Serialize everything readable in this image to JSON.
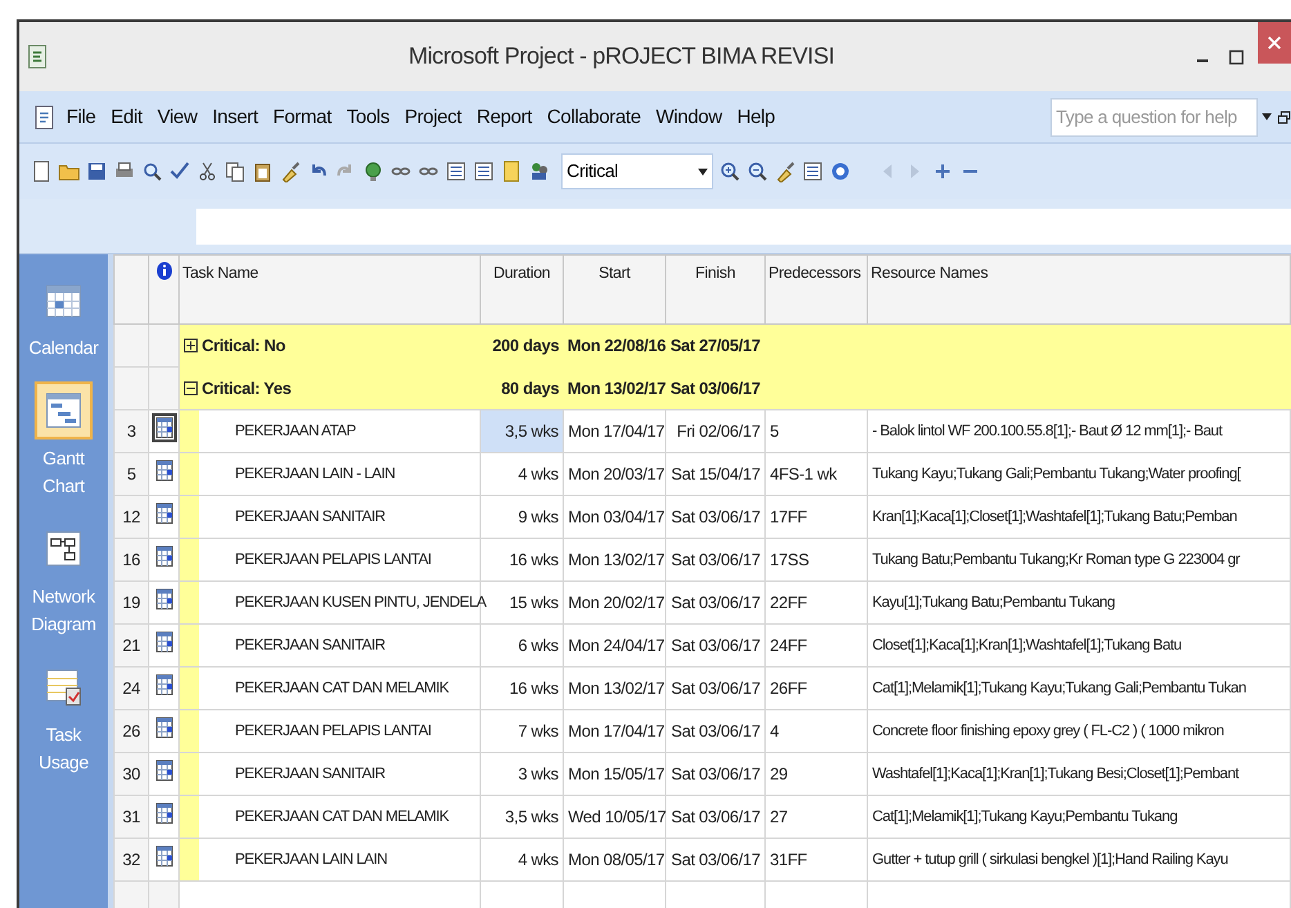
{
  "window": {
    "title": "Microsoft Project - pROJECT BIMA REVISI"
  },
  "menu": [
    "File",
    "Edit",
    "View",
    "Insert",
    "Format",
    "Tools",
    "Project",
    "Report",
    "Collaborate",
    "Window",
    "Help"
  ],
  "help_box": {
    "placeholder": "Type a question for help"
  },
  "toolbar": {
    "filter": "Critical"
  },
  "sidebar": {
    "items": [
      {
        "label": "Calendar",
        "selected": false
      },
      {
        "label": "Gantt Chart",
        "selected": true
      },
      {
        "label": "Network Diagram",
        "selected": false
      },
      {
        "label": "Task Usage",
        "selected": false
      }
    ]
  },
  "table": {
    "columns": [
      "Task Name",
      "Duration",
      "Start",
      "Finish",
      "Predecessors",
      "Resource Names"
    ],
    "groups": [
      {
        "label": "Critical: No",
        "expanded": false,
        "duration": "200 days",
        "start": "Mon 22/08/16",
        "finish": "Sat 27/05/17"
      },
      {
        "label": "Critical: Yes",
        "expanded": true,
        "duration": "80 days",
        "start": "Mon 13/02/17",
        "finish": "Sat 03/06/17"
      }
    ],
    "rows": [
      {
        "id": "3",
        "name": "PEKERJAAN ATAP",
        "duration": "3,5 wks",
        "start": "Mon 17/04/17",
        "finish": "Fri 02/06/17",
        "predecessors": "5",
        "resources": "- Balok lintol WF 200.100.55.8[1];- Baut  Ø 12 mm[1];- Baut",
        "selected": true
      },
      {
        "id": "5",
        "name": "PEKERJAAN LAIN - LAIN",
        "duration": "4 wks",
        "start": "Mon 20/03/17",
        "finish": "Sat 15/04/17",
        "predecessors": "4FS-1 wk",
        "resources": "Tukang Kayu;Tukang Gali;Pembantu Tukang;Water proofing[",
        "selected": false
      },
      {
        "id": "12",
        "name": "PEKERJAAN SANITAIR",
        "duration": "9 wks",
        "start": "Mon 03/04/17",
        "finish": "Sat 03/06/17",
        "predecessors": "17FF",
        "resources": "Kran[1];Kaca[1];Closet[1];Washtafel[1];Tukang Batu;Pemban",
        "selected": false
      },
      {
        "id": "16",
        "name": "PEKERJAAN PELAPIS LANTAI",
        "duration": "16 wks",
        "start": "Mon 13/02/17",
        "finish": "Sat 03/06/17",
        "predecessors": "17SS",
        "resources": "Tukang Batu;Pembantu Tukang;Kr Roman  type G 223004 gr",
        "selected": false
      },
      {
        "id": "19",
        "name": "PEKERJAAN KUSEN PINTU, JENDELA",
        "duration": "15 wks",
        "start": "Mon 20/02/17",
        "finish": "Sat 03/06/17",
        "predecessors": "22FF",
        "resources": "Kayu[1];Tukang Batu;Pembantu Tukang",
        "selected": false
      },
      {
        "id": "21",
        "name": "PEKERJAAN SANITAIR",
        "duration": "6 wks",
        "start": "Mon 24/04/17",
        "finish": "Sat 03/06/17",
        "predecessors": "24FF",
        "resources": "Closet[1];Kaca[1];Kran[1];Washtafel[1];Tukang Batu",
        "selected": false
      },
      {
        "id": "24",
        "name": "PEKERJAAN CAT DAN MELAMIK",
        "duration": "16 wks",
        "start": "Mon 13/02/17",
        "finish": "Sat 03/06/17",
        "predecessors": "26FF",
        "resources": "Cat[1];Melamik[1];Tukang Kayu;Tukang Gali;Pembantu Tukan",
        "selected": false
      },
      {
        "id": "26",
        "name": "PEKERJAAN PELAPIS LANTAI",
        "duration": "7 wks",
        "start": "Mon 17/04/17",
        "finish": "Sat 03/06/17",
        "predecessors": "4",
        "resources": "Concrete floor finishing epoxy  grey ( FL-C2 )  ( 1000 mikron",
        "selected": false
      },
      {
        "id": "30",
        "name": "PEKERJAAN SANITAIR",
        "duration": "3 wks",
        "start": "Mon 15/05/17",
        "finish": "Sat 03/06/17",
        "predecessors": "29",
        "resources": "Washtafel[1];Kaca[1];Kran[1];Tukang Besi;Closet[1];Pembant",
        "selected": false
      },
      {
        "id": "31",
        "name": "PEKERJAAN CAT DAN MELAMIK",
        "duration": "3,5 wks",
        "start": "Wed 10/05/17",
        "finish": "Sat 03/06/17",
        "predecessors": "27",
        "resources": "Cat[1];Melamik[1];Tukang Kayu;Pembantu Tukang",
        "selected": false
      },
      {
        "id": "32",
        "name": "PEKERJAAN LAIN LAIN",
        "duration": "4 wks",
        "start": "Mon 08/05/17",
        "finish": "Sat 03/06/17",
        "predecessors": "31FF",
        "resources": "Gutter + tutup grill ( sirkulasi bengkel )[1];Hand Railing Kayu",
        "selected": false
      }
    ]
  }
}
